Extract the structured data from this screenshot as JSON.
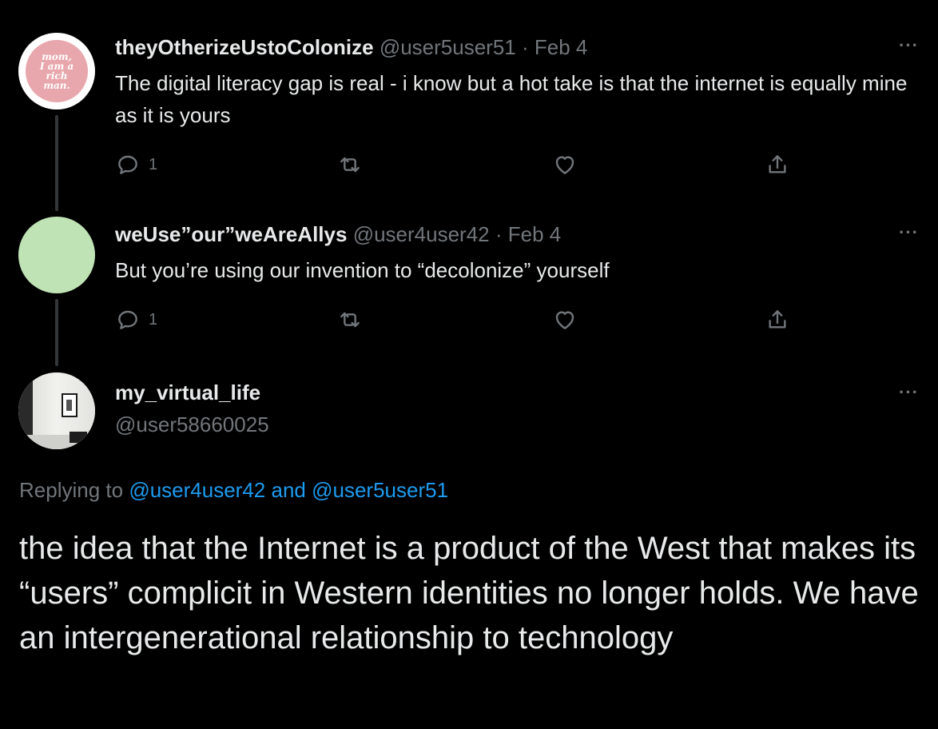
{
  "thread": [
    {
      "avatar_text": "mom,\nI am a\nrich\nman.",
      "name": "theyOtherizeUstoColonize",
      "handle": "@user5user51",
      "separator": "·",
      "date": "Feb 4",
      "text": "The digital literacy gap is real - i know but a hot take is that the internet is equally mine as it is yours",
      "reply_count": "1",
      "more_label": "···"
    },
    {
      "name": "weUse”our”weAreAllys",
      "handle": "@user4user42",
      "separator": "·",
      "date": "Feb 4",
      "text": "But you’re using our invention to “decolonize” yourself",
      "reply_count": "1",
      "more_label": "···"
    }
  ],
  "focus": {
    "name": "my_virtual_life",
    "handle": "@user58660025",
    "more_label": "···",
    "replying_prefix": "Replying to",
    "replying_user1": "@user4user42",
    "replying_and": "and",
    "replying_user2": "@user5user51",
    "text": "the idea that the Internet is a product of the West that makes its “users” complicit in Western identities no longer holds. We have an intergenerational relationship to technology"
  },
  "colors": {
    "background": "#000000",
    "text": "#e7e9ea",
    "muted": "#71767b",
    "link": "#1d9bf0",
    "thread_line": "#333639"
  }
}
